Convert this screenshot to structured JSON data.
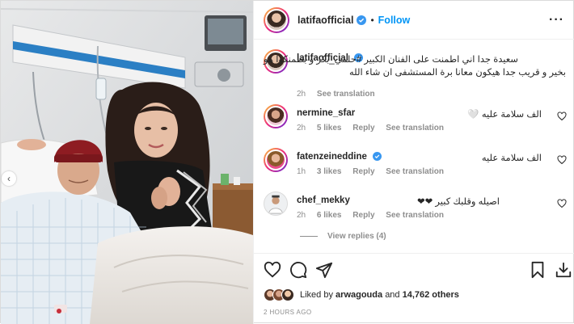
{
  "post": {
    "username": "latifaofficial",
    "follow_label": "Follow",
    "separator": "•",
    "more_icon": "more-horizontal-icon",
    "caption": {
      "username": "latifaofficial",
      "text_line1": "سعيدة جدا اني اطمنت على الفنان الكبير #حلمي_بكر و بطمنكوا هو",
      "text_line2": "بخير و قريب جدا هيكون معانا برة المستشفى ان شاء الله",
      "time": "2h",
      "see_translation": "See translation"
    },
    "comments": [
      {
        "username": "nermine_sfar",
        "text": "الف سلامة عليه 🤍",
        "time": "2h",
        "likes": "5 likes",
        "reply": "Reply",
        "see_translation": "See translation"
      },
      {
        "username": "fatenzeineddine",
        "text": "الف سلامة عليه",
        "time": "1h",
        "likes": "3 likes",
        "reply": "Reply",
        "see_translation": "See translation"
      },
      {
        "username": "chef_mekky",
        "text": "اصيله وقلبك كبير ❤❤",
        "time": "2h",
        "likes": "6 likes",
        "reply": "Reply",
        "see_translation": "See translation"
      }
    ],
    "view_replies": "View replies (4)",
    "liked_by_prefix": "Liked by",
    "liked_by_user": "arwagouda",
    "liked_by_and": "and",
    "liked_by_count": "14,762 others",
    "time_ago": "2 HOURS AGO",
    "colors": {
      "link": "#0095f6",
      "muted": "#8e8e8e",
      "text": "#262626",
      "verified": "#3897f0"
    }
  }
}
